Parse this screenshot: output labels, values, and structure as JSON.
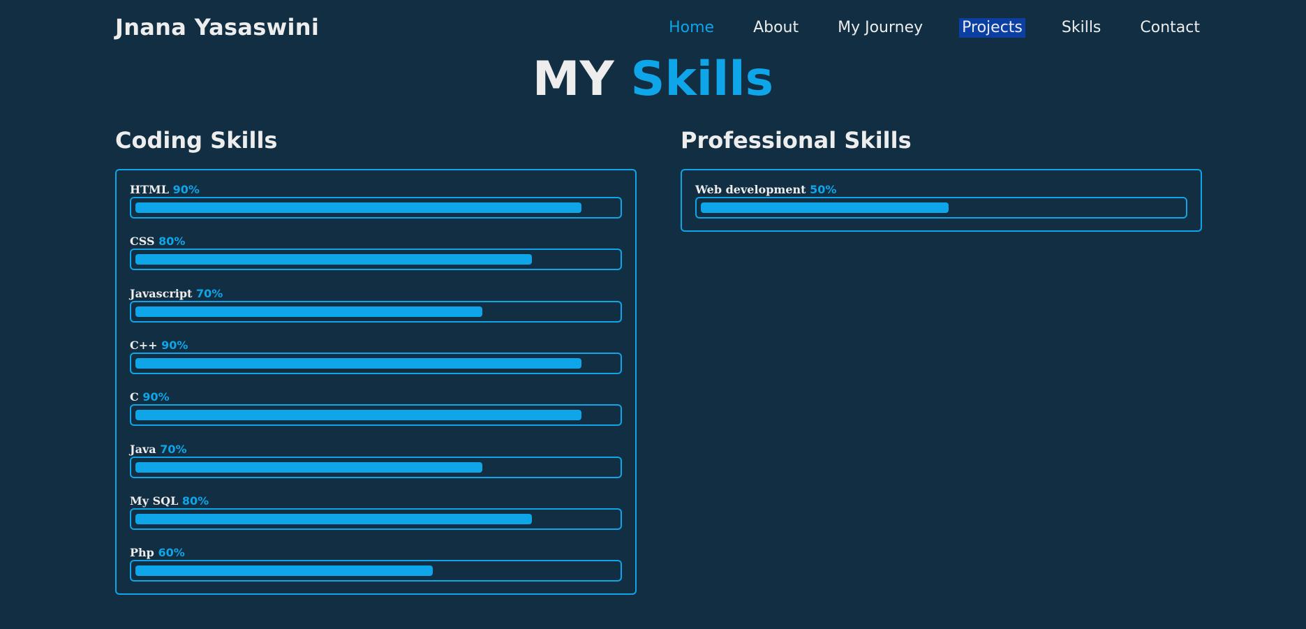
{
  "header": {
    "logo": "Jnana Yasaswini",
    "nav": [
      {
        "label": "Home",
        "state": "active"
      },
      {
        "label": "About",
        "state": "normal"
      },
      {
        "label": "My Journey",
        "state": "normal"
      },
      {
        "label": "Projects",
        "state": "highlighted"
      },
      {
        "label": "Skills",
        "state": "normal"
      },
      {
        "label": "Contact",
        "state": "normal"
      }
    ]
  },
  "title": {
    "prefix": "MY",
    "accent": "Skills"
  },
  "colors": {
    "background": "#112e42",
    "accent": "#0ea5e9",
    "text": "#ededed",
    "highlight": "#0b3fa3"
  },
  "coding": {
    "heading": "Coding Skills",
    "skills": [
      {
        "name": "HTML",
        "percent": "90%",
        "level": 90
      },
      {
        "name": "CSS",
        "percent": "80%",
        "level": 80
      },
      {
        "name": "Javascript",
        "percent": "70%",
        "level": 70
      },
      {
        "name": "C++",
        "percent": "90%",
        "level": 90
      },
      {
        "name": "C",
        "percent": "90%",
        "level": 90
      },
      {
        "name": "Java",
        "percent": "70%",
        "level": 70
      },
      {
        "name": "My SQL",
        "percent": "80%",
        "level": 80
      },
      {
        "name": "Php",
        "percent": "60%",
        "level": 60
      }
    ]
  },
  "professional": {
    "heading": "Professional Skills",
    "skills": [
      {
        "name": "Web development",
        "percent": "50%",
        "level": 50
      }
    ]
  }
}
